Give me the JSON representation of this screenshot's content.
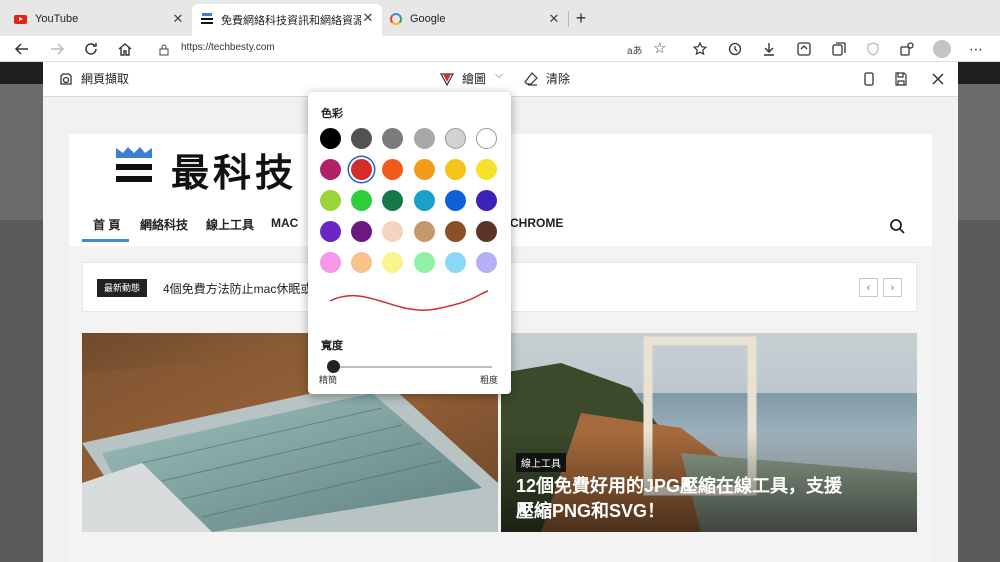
{
  "tabs": [
    {
      "title": "YouTube",
      "active": false
    },
    {
      "title": "免費網絡科技資訊和網絡資源教學",
      "active": true
    },
    {
      "title": "Google",
      "active": false
    }
  ],
  "address": {
    "url": "https://techbesty.com",
    "read_aloud": "aあ"
  },
  "capture": {
    "title": "網頁擷取",
    "draw_label": "繪圖",
    "erase_label": "清除"
  },
  "draw_popover": {
    "color_heading": "色彩",
    "width_heading": "寬度",
    "width_min_label": "精簡",
    "width_max_label": "粗度",
    "selected_color": "#d42b2b",
    "pen_width": 0.02,
    "colors": [
      [
        "#000000",
        "#525252",
        "#7b7b7b",
        "#a8a8a8",
        "#d2d2d2",
        "#ffffff"
      ],
      [
        "#b0216a",
        "#d42b2b",
        "#f25a1c",
        "#f59b1c",
        "#f7c21a",
        "#f6e22a"
      ],
      [
        "#9cd33a",
        "#2ecf3a",
        "#157a4a",
        "#1aa0c9",
        "#1060d8",
        "#3b22b8"
      ],
      [
        "#6a27c6",
        "#6b1880",
        "#f5d4bf",
        "#c4996c",
        "#8a4f26",
        "#5b3428"
      ],
      [
        "#f896e9",
        "#f9c18b",
        "#f9f48e",
        "#8ff0a6",
        "#89d8f5",
        "#b8b0f5"
      ]
    ]
  },
  "site": {
    "logo": "最科技",
    "nav": [
      "首 頁",
      "網絡科技",
      "線上工具",
      "MAC",
      "CHROME"
    ],
    "ticker": {
      "badge": "最新動態",
      "headline": "4個免費方法防止mac休眠或"
    },
    "hero": {
      "tag": "線上工具",
      "title": "12個免費好用的JPG壓縮在線工具，支援壓縮PNG和SVG！"
    }
  }
}
